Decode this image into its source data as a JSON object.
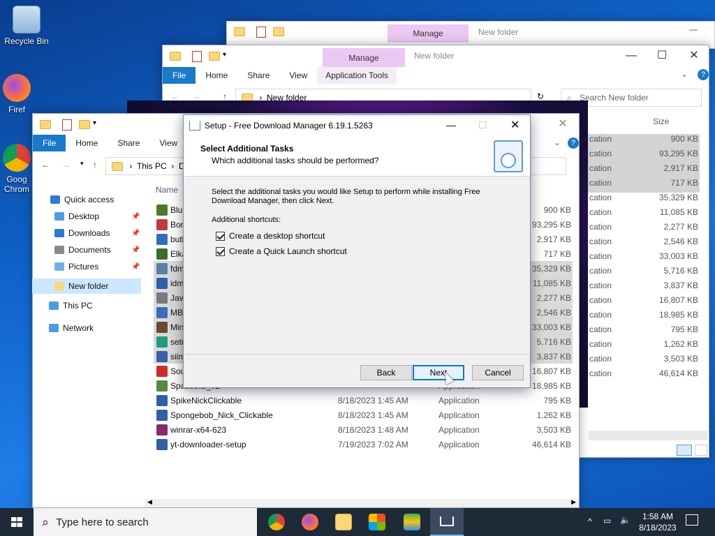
{
  "desktop": {
    "icons": [
      {
        "label": "Recycle Bin",
        "icon": "recycle-bin-icon"
      },
      {
        "label": "Firef",
        "icon": "firefox-icon"
      },
      {
        "label": "Goog Chrom",
        "icon": "chrome-icon"
      }
    ]
  },
  "back_window": {
    "manage": "Manage",
    "title": "New folder"
  },
  "mid_window": {
    "manage": "Manage",
    "title": "New folder",
    "tabs": [
      "File",
      "Home",
      "Share",
      "View",
      "Application Tools"
    ],
    "address": "New folder",
    "search_placeholder": "Search New folder",
    "size_header": "Size",
    "rows": [
      {
        "type": "cation",
        "size": "900 KB",
        "selected": true
      },
      {
        "type": "cation",
        "size": "93,295 KB",
        "selected": true
      },
      {
        "type": "cation",
        "size": "2,917 KB",
        "selected": true
      },
      {
        "type": "cation",
        "size": "717 KB",
        "selected": true
      },
      {
        "type": "cation",
        "size": "35,329 KB",
        "selected": false
      },
      {
        "type": "cation",
        "size": "11,085 KB",
        "selected": false
      },
      {
        "type": "cation",
        "size": "2,277 KB",
        "selected": false
      },
      {
        "type": "cation",
        "size": "2,546 KB",
        "selected": false
      },
      {
        "type": "cation",
        "size": "33,003 KB",
        "selected": false
      },
      {
        "type": "cation",
        "size": "5,716 KB",
        "selected": false
      },
      {
        "type": "cation",
        "size": "3,837 KB",
        "selected": false
      },
      {
        "type": "cation",
        "size": "16,807 KB",
        "selected": false
      },
      {
        "type": "cation",
        "size": "18,985 KB",
        "selected": false
      },
      {
        "type": "cation",
        "size": "795 KB",
        "selected": false
      },
      {
        "type": "cation",
        "size": "1,262 KB",
        "selected": false
      },
      {
        "type": "cation",
        "size": "3,503 KB",
        "selected": false
      },
      {
        "type": "cation",
        "size": "46,614 KB",
        "selected": false
      }
    ]
  },
  "front_window": {
    "tabs": [
      "File",
      "Home",
      "Share",
      "View"
    ],
    "address": [
      "This PC",
      "D"
    ],
    "name_header": "Name",
    "nav": [
      {
        "label": "Quick access",
        "icon": "star-icon"
      },
      {
        "label": "Desktop",
        "icon": "desktop-icon"
      },
      {
        "label": "Downloads",
        "icon": "download-icon"
      },
      {
        "label": "Documents",
        "icon": "documents-icon"
      },
      {
        "label": "Pictures",
        "icon": "pictures-icon"
      },
      {
        "label": "New folder",
        "icon": "folder-icon"
      },
      {
        "label": "This PC",
        "icon": "computer-icon"
      },
      {
        "label": "Network",
        "icon": "network-icon"
      }
    ],
    "files": [
      {
        "name": "Blu",
        "date": "",
        "type": "",
        "size": "900 KB",
        "color": "#4a7a2a",
        "selected": false
      },
      {
        "name": "Bor",
        "date": "",
        "type": "",
        "size": "93,295 KB",
        "color": "#c23a3a",
        "selected": false
      },
      {
        "name": "butl",
        "date": "",
        "type": "",
        "size": "2,917 KB",
        "color": "#2f6fbf",
        "selected": false
      },
      {
        "name": "Elka",
        "date": "",
        "type": "",
        "size": "717 KB",
        "color": "#3b6e2b",
        "selected": false
      },
      {
        "name": "fdm",
        "date": "",
        "type": "",
        "size": "35,329 KB",
        "color": "#5b7fa6",
        "selected": true
      },
      {
        "name": "idm",
        "date": "",
        "type": "",
        "size": "11,085 KB",
        "color": "#2d5fa8",
        "selected": true
      },
      {
        "name": "Java",
        "date": "",
        "type": "",
        "size": "2,277 KB",
        "color": "#7a7a7a",
        "selected": true
      },
      {
        "name": "MB",
        "date": "",
        "type": "",
        "size": "2,546 KB",
        "color": "#3a6db5",
        "selected": true
      },
      {
        "name": "Min",
        "date": "",
        "type": "",
        "size": "33,003 KB",
        "color": "#6b4a2a",
        "selected": true
      },
      {
        "name": "setu",
        "date": "",
        "type": "",
        "size": "5,716 KB",
        "color": "#1f9c7a",
        "selected": true
      },
      {
        "name": "siin",
        "date": "",
        "type": "",
        "size": "3,837 KB",
        "color": "#3a5fa8",
        "selected": true
      },
      {
        "name": "Sou",
        "date": "",
        "type": "",
        "size": "16,807 KB",
        "color": "#d42a2a",
        "selected": false
      },
      {
        "name": "Spatiticks_v2",
        "date": "",
        "type": "Application",
        "size": "18,985 KB",
        "color": "#5a8a3a",
        "selected": false
      },
      {
        "name": "SpikeNickClickable",
        "date": "8/18/2023 1:45 AM",
        "type": "Application",
        "size": "795 KB",
        "color": "#2f5fa8",
        "selected": false
      },
      {
        "name": "Spongebob_Nick_Clickable",
        "date": "8/18/2023 1:45 AM",
        "type": "Application",
        "size": "1,262 KB",
        "color": "#2f5fa8",
        "selected": false
      },
      {
        "name": "winrar-x64-623",
        "date": "8/18/2023 1:48 AM",
        "type": "Application",
        "size": "3,503 KB",
        "color": "#8a2a6a",
        "selected": false
      },
      {
        "name": "yt-downloader-setup",
        "date": "7/19/2023 7:02 AM",
        "type": "Application",
        "size": "46,614 KB",
        "color": "#2f5fa8",
        "selected": false
      }
    ]
  },
  "dialog": {
    "title": "Setup - Free Download Manager 6.19.1.5263",
    "heading": "Select Additional Tasks",
    "subheading": "Which additional tasks should be performed?",
    "instruction": "Select the additional tasks you would like Setup to perform while installing Free Download Manager, then click Next.",
    "group_label": "Additional shortcuts:",
    "checkboxes": [
      {
        "label": "Create a desktop shortcut",
        "checked": true
      },
      {
        "label": "Create a Quick Launch shortcut",
        "checked": true
      }
    ],
    "back": "Back",
    "next": "Next",
    "cancel": "Cancel"
  },
  "taskbar": {
    "search_placeholder": "Type here to search",
    "time": "1:58 AM",
    "date": "8/18/2023"
  }
}
